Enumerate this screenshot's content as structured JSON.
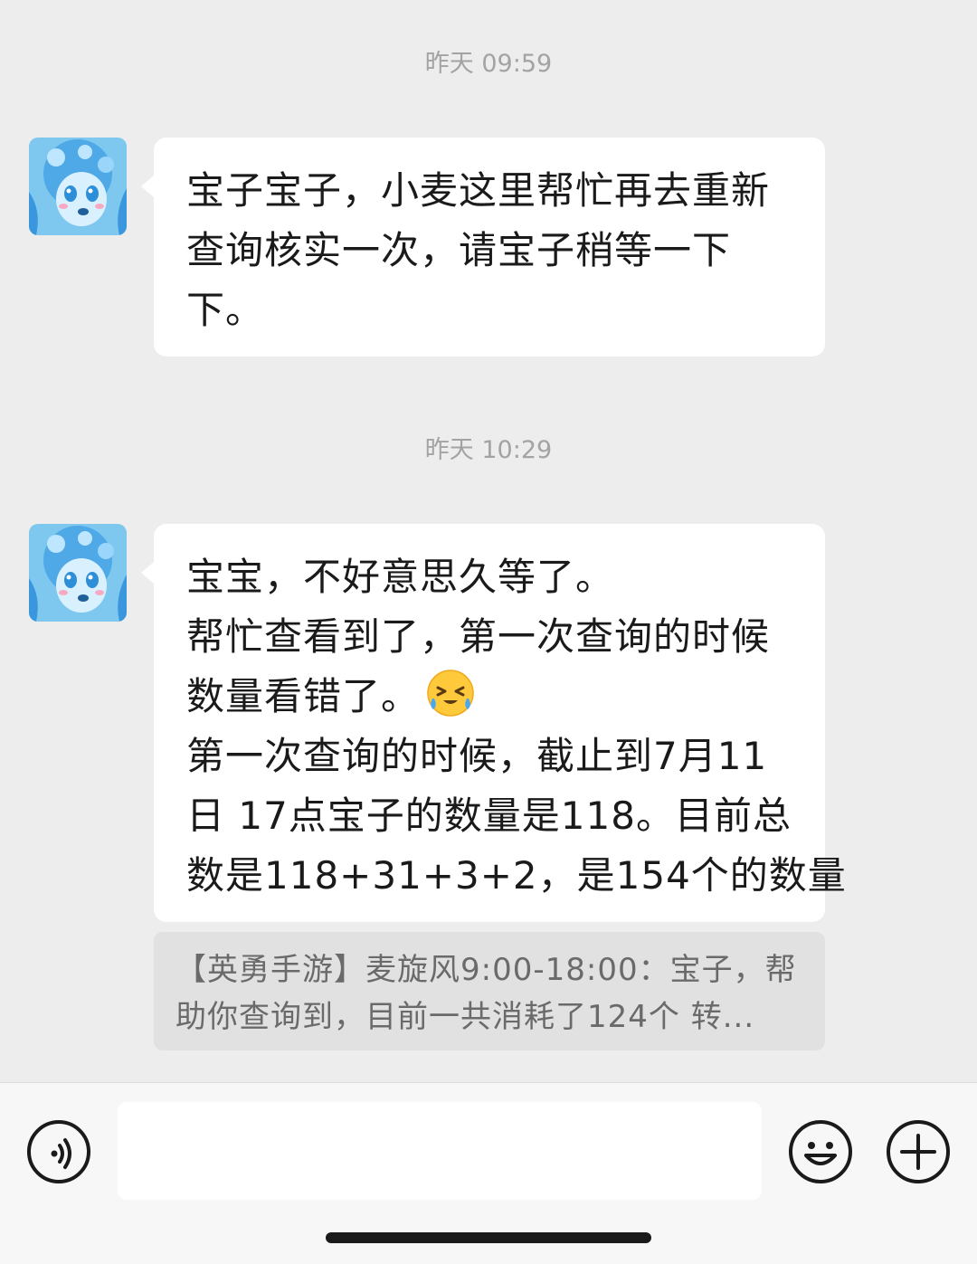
{
  "messages": [
    {
      "timestamp": "昨天 09:59",
      "lines": [
        "宝子宝子，小麦这里帮忙再去重新",
        "查询核实一次，请宝子稍等一下",
        "下。"
      ]
    },
    {
      "timestamp": "昨天 10:29",
      "lines": [
        "宝宝，不好意思久等了。",
        "帮忙查看到了，第一次查询的时候",
        "数量看错了。",
        "第一次查询的时候，截止到7月11",
        "日 17点宝子的数量是118。目前总",
        "数是118+31+3+2，是154个的数量"
      ],
      "emoji": "laughing-tears-emoji"
    }
  ],
  "quote": {
    "lines": [
      "【英勇手游】麦旋风9:00-18:00：宝子，帮",
      "助你查询到，目前一共消耗了124个 转..."
    ]
  },
  "input": {
    "placeholder": ""
  },
  "icons": {
    "voice": "voice-icon",
    "emoji": "emoji-icon",
    "plus": "plus-icon"
  },
  "colors": {
    "background": "#ededed",
    "bubble": "#ffffff",
    "quote": "#e1e1e1",
    "timestamp": "#a3a3a3"
  }
}
